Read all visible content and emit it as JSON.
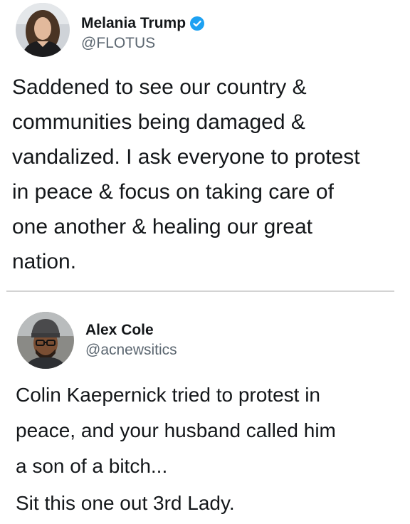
{
  "tweets": [
    {
      "display_name": "Melania Trump",
      "handle": "@FLOTUS",
      "verified": true,
      "text": "Saddened to see our country &\ncommunities being damaged &\nvandalized. I ask everyone to protest\nin peace & focus on taking care of\none another & healing our great\nnation."
    },
    {
      "display_name": "Alex Cole",
      "handle": "@acnewsitics",
      "verified": false,
      "text_paragraphs": [
        "Colin Kaepernick tried to protest in\npeace, and your husband called him\na son of a bitch...",
        "Sit this one out 3rd Lady."
      ]
    }
  ],
  "colors": {
    "verified_badge": "#1da1f2",
    "handle": "#5b6670",
    "divider": "#d3d3d3"
  }
}
